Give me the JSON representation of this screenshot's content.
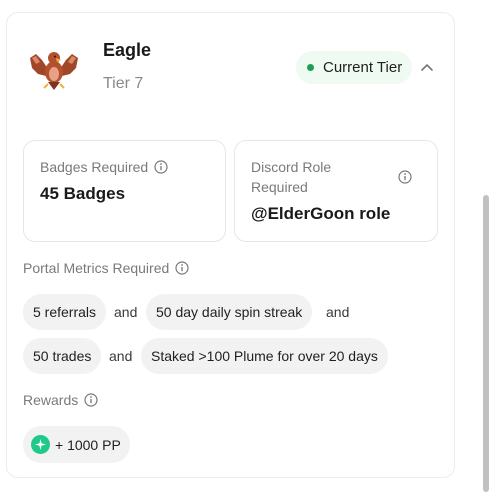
{
  "tier": {
    "name": "Eagle",
    "level": "Tier 7",
    "status": "Current Tier",
    "status_color": "#1f9d55",
    "avatar_icon": "eagle-icon"
  },
  "requirements": {
    "badges": {
      "label": "Badges Required",
      "value": "45 Badges"
    },
    "discord": {
      "label_line1": "Discord Role",
      "label_line2": "Required",
      "value": "@ElderGoon role"
    }
  },
  "portal_metrics": {
    "label": "Portal Metrics Required",
    "items": [
      "5 referrals",
      "50 day daily spin streak",
      "50 trades",
      "Staked >100 Plume for over 20 days"
    ],
    "connector": "and"
  },
  "rewards": {
    "label": "Rewards",
    "items": [
      "+ 1000 PP"
    ],
    "icon": "pp-icon",
    "icon_color": "#1fc98a"
  }
}
